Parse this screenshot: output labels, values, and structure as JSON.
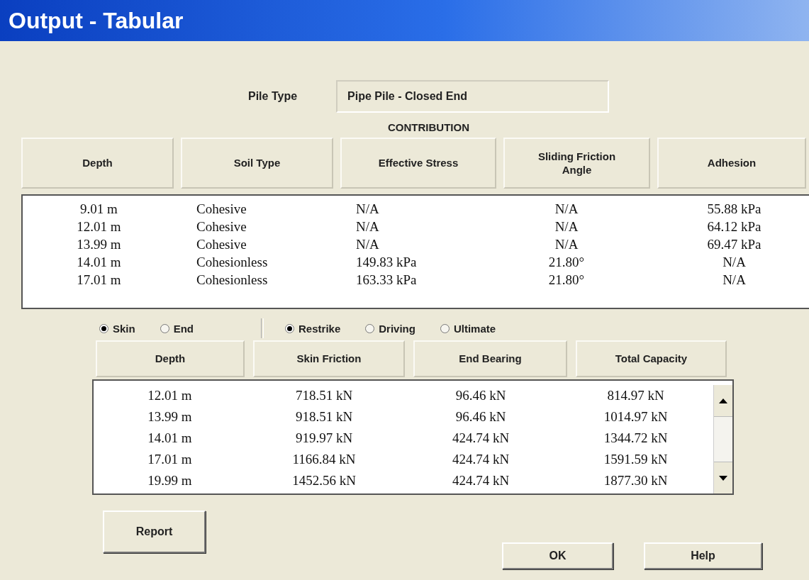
{
  "window": {
    "title": "Output - Tabular"
  },
  "pile_type": {
    "label": "Pile Type",
    "value": "Pipe Pile - Closed End"
  },
  "contribution": {
    "title": "CONTRIBUTION",
    "columns": [
      "Depth",
      "Soil Type",
      "Effective Stress",
      "Sliding Friction Angle",
      "Adhesion"
    ],
    "rows": [
      [
        "9.01 m",
        "Cohesive",
        "N/A",
        "N/A",
        "55.88 kPa"
      ],
      [
        "12.01 m",
        "Cohesive",
        "N/A",
        "N/A",
        "64.12 kPa"
      ],
      [
        "13.99 m",
        "Cohesive",
        "N/A",
        "N/A",
        "69.47 kPa"
      ],
      [
        "14.01 m",
        "Cohesionless",
        "149.83 kPa",
        "21.80°",
        "N/A"
      ],
      [
        "17.01 m",
        "Cohesionless",
        "163.33 kPa",
        "21.80°",
        "N/A"
      ]
    ]
  },
  "component_options": [
    {
      "label": "Skin",
      "selected": true
    },
    {
      "label": "End",
      "selected": false
    }
  ],
  "condition_options": [
    {
      "label": "Restrike",
      "selected": true
    },
    {
      "label": "Driving",
      "selected": false
    },
    {
      "label": "Ultimate",
      "selected": false
    }
  ],
  "capacity": {
    "columns": [
      "Depth",
      "Skin Friction",
      "End Bearing",
      "Total Capacity"
    ],
    "rows": [
      [
        "12.01 m",
        "718.51 kN",
        "96.46 kN",
        "814.97 kN"
      ],
      [
        "13.99 m",
        "918.51 kN",
        "96.46 kN",
        "1014.97 kN"
      ],
      [
        "14.01 m",
        "919.97 kN",
        "424.74 kN",
        "1344.72 kN"
      ],
      [
        "17.01 m",
        "1166.84 kN",
        "424.74 kN",
        "1591.59 kN"
      ],
      [
        "19.99 m",
        "1452.56 kN",
        "424.74 kN",
        "1877.30 kN"
      ]
    ]
  },
  "buttons": {
    "report": "Report",
    "ok": "OK",
    "help": "Help"
  }
}
